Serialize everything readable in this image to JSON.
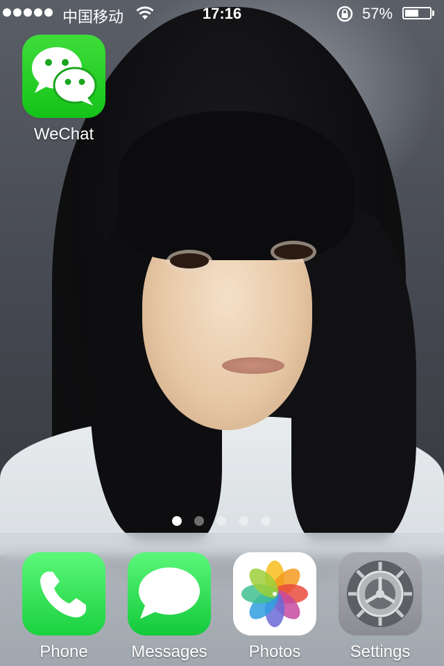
{
  "status_bar": {
    "carrier": "中国移动",
    "time": "17:16",
    "battery_percent": "57%",
    "battery_level": 0.57,
    "signal_dots": 5,
    "icons": [
      "wifi-icon",
      "orientation-lock-icon",
      "battery-icon"
    ]
  },
  "home_apps": [
    {
      "label": "WeChat",
      "icon": "wechat-icon",
      "color": "#1AC41F"
    }
  ],
  "page_indicator": {
    "pages": 5,
    "current": 1
  },
  "dock": {
    "apps": [
      {
        "label": "Phone",
        "icon": "phone-icon",
        "color": "#2BD94C"
      },
      {
        "label": "Messages",
        "icon": "messages-icon",
        "color": "#2BD94C"
      },
      {
        "label": "Photos",
        "icon": "photos-icon",
        "color": "#FFFFFF"
      },
      {
        "label": "Settings",
        "icon": "settings-icon",
        "color": "#8E8E93"
      }
    ]
  }
}
